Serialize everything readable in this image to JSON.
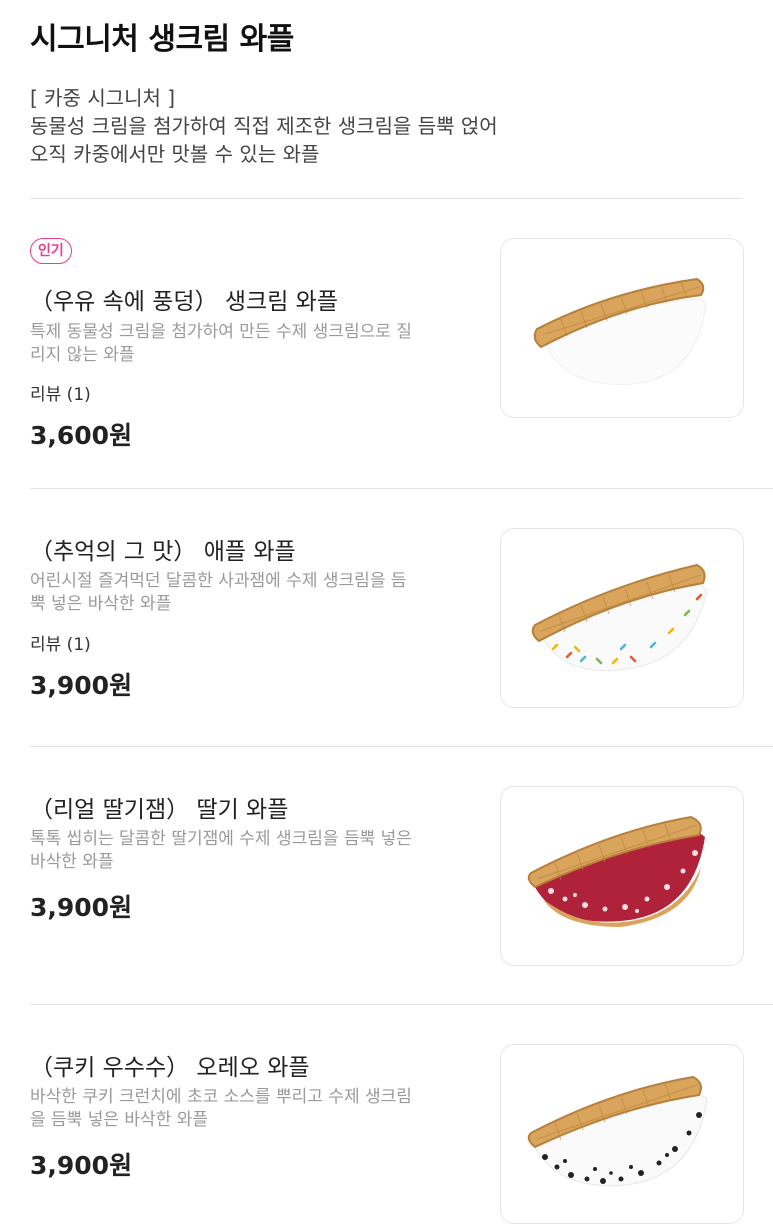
{
  "page": {
    "title": "시그니처 생크림 와플",
    "intro_lines": [
      "[ 카중 시그니처 ]",
      "동물성 크림을 첨가하여 직접 제조한 생크림을 듬뿍 얹어",
      "오직 카중에서만 맛볼 수 있는 와플"
    ]
  },
  "items": [
    {
      "badge": "인기",
      "name": "（우유 속에 풍덩） 생크림 와플",
      "desc_lines": [
        "특제 동물성 크림을 첨가하여 만든 수제 생크림으로 질",
        "리지 않는 와플"
      ],
      "review": "리뷰 (1)",
      "price": "3,600원",
      "image": "plain-cream-waffle"
    },
    {
      "badge": "",
      "name": "（추억의 그 맛） 애플 와플",
      "desc_lines": [
        "어린시절 즐겨먹던 달콤한 사과잼에 수제 생크림을 듬",
        "뿍 넣은 바삭한 와플"
      ],
      "review": "리뷰 (1)",
      "price": "3,900원",
      "image": "apple-waffle-with-sprinkles"
    },
    {
      "badge": "",
      "name": "（리얼 딸기잼） 딸기 와플",
      "desc_lines": [
        "톡톡 씹히는 달콤한 딸기잼에 수제 생크림을 듬뿍 넣은",
        "바삭한 와플"
      ],
      "review": "",
      "price": "3,900원",
      "image": "strawberry-waffle"
    },
    {
      "badge": "",
      "name": "（쿠키 우수수） 오레오 와플",
      "desc_lines": [
        "바삭한 쿠키 크런치에 초코 소스를 뿌리고 수제 생크림",
        "을 듬뿍 넣은 바삭한 와플"
      ],
      "review": "",
      "price": "3,900원",
      "image": "oreo-waffle"
    }
  ],
  "colors": {
    "badge_accent": "#e83e8c",
    "waffle": "#d9a45c",
    "cream": "#ffffff",
    "strawberry": "#b0213a",
    "oreo_crumbs": "#222222"
  }
}
